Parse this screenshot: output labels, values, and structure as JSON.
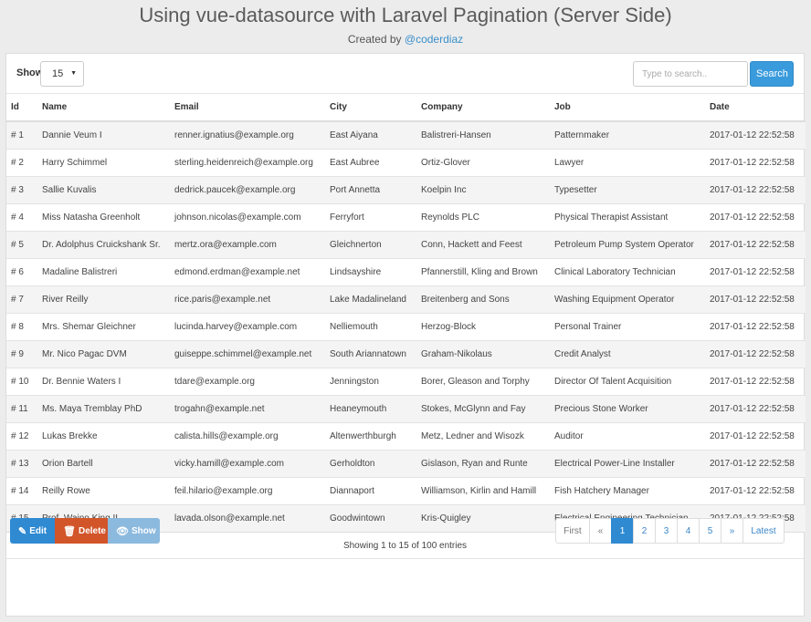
{
  "header": {
    "title": "Using vue-datasource with Laravel Pagination (Server Side)",
    "created_by": "Created by",
    "author_link": "@coderdiaz"
  },
  "toolbar": {
    "show_label": "Show",
    "show_value": "15",
    "search_placeholder": "Type to search..",
    "search_label": "Search"
  },
  "table": {
    "columns": [
      "Id",
      "Name",
      "Email",
      "City",
      "Company",
      "Job",
      "Date"
    ],
    "rows": [
      [
        "# 1",
        "Dannie Veum I",
        "renner.ignatius@example.org",
        "East Aiyana",
        "Balistreri-Hansen",
        "Patternmaker",
        "2017-01-12 22:52:58"
      ],
      [
        "# 2",
        "Harry Schimmel",
        "sterling.heidenreich@example.org",
        "East Aubree",
        "Ortiz-Glover",
        "Lawyer",
        "2017-01-12 22:52:58"
      ],
      [
        "# 3",
        "Sallie Kuvalis",
        "dedrick.paucek@example.org",
        "Port Annetta",
        "Koelpin Inc",
        "Typesetter",
        "2017-01-12 22:52:58"
      ],
      [
        "# 4",
        "Miss Natasha Greenholt",
        "johnson.nicolas@example.com",
        "Ferryfort",
        "Reynolds PLC",
        "Physical Therapist Assistant",
        "2017-01-12 22:52:58"
      ],
      [
        "# 5",
        "Dr. Adolphus Cruickshank Sr.",
        "mertz.ora@example.com",
        "Gleichnerton",
        "Conn, Hackett and Feest",
        "Petroleum Pump System Operator",
        "2017-01-12 22:52:58"
      ],
      [
        "# 6",
        "Madaline Balistreri",
        "edmond.erdman@example.net",
        "Lindsayshire",
        "Pfannerstill, Kling and Brown",
        "Clinical Laboratory Technician",
        "2017-01-12 22:52:58"
      ],
      [
        "# 7",
        "River Reilly",
        "rice.paris@example.net",
        "Lake Madalineland",
        "Breitenberg and Sons",
        "Washing Equipment Operator",
        "2017-01-12 22:52:58"
      ],
      [
        "# 8",
        "Mrs. Shemar Gleichner",
        "lucinda.harvey@example.com",
        "Nelliemouth",
        "Herzog-Block",
        "Personal Trainer",
        "2017-01-12 22:52:58"
      ],
      [
        "# 9",
        "Mr. Nico Pagac DVM",
        "guiseppe.schimmel@example.net",
        "South Ariannatown",
        "Graham-Nikolaus",
        "Credit Analyst",
        "2017-01-12 22:52:58"
      ],
      [
        "# 10",
        "Dr. Bennie Waters I",
        "tdare@example.org",
        "Jenningston",
        "Borer, Gleason and Torphy",
        "Director Of Talent Acquisition",
        "2017-01-12 22:52:58"
      ],
      [
        "# 11",
        "Ms. Maya Tremblay PhD",
        "trogahn@example.net",
        "Heaneymouth",
        "Stokes, McGlynn and Fay",
        "Precious Stone Worker",
        "2017-01-12 22:52:58"
      ],
      [
        "# 12",
        "Lukas Brekke",
        "calista.hills@example.org",
        "Altenwerthburgh",
        "Metz, Ledner and Wisozk",
        "Auditor",
        "2017-01-12 22:52:58"
      ],
      [
        "# 13",
        "Orion Bartell",
        "vicky.hamill@example.com",
        "Gerholdton",
        "Gislason, Ryan and Runte",
        "Electrical Power-Line Installer",
        "2017-01-12 22:52:58"
      ],
      [
        "# 14",
        "Reilly Rowe",
        "feil.hilario@example.org",
        "Diannaport",
        "Williamson, Kirlin and Hamill",
        "Fish Hatchery Manager",
        "2017-01-12 22:52:58"
      ],
      [
        "# 15",
        "Prof. Waino King II",
        "lavada.olson@example.net",
        "Goodwintown",
        "Kris-Quigley",
        "Electrical Engineering Technician",
        "2017-01-12 22:52:58"
      ]
    ]
  },
  "footer": {
    "info": "Showing 1 to 15 of 100 entries"
  },
  "actions": {
    "edit_label": "Edit",
    "delete_label": "Delete",
    "show_label": "Show",
    "edit_icon": "pencil-icon",
    "delete_icon": "trash-icon",
    "show_icon": "eye-icon"
  },
  "pagination": {
    "first_label": "First",
    "prev_label": "«",
    "pages": [
      "1",
      "2",
      "3",
      "4",
      "5"
    ],
    "active_page": "1",
    "next_label": "»",
    "latest_label": "Latest"
  },
  "colors": {
    "primary": "#2f8ad2",
    "danger": "#d2552a",
    "info": "#8cb9de",
    "link": "#3a8fc9"
  }
}
